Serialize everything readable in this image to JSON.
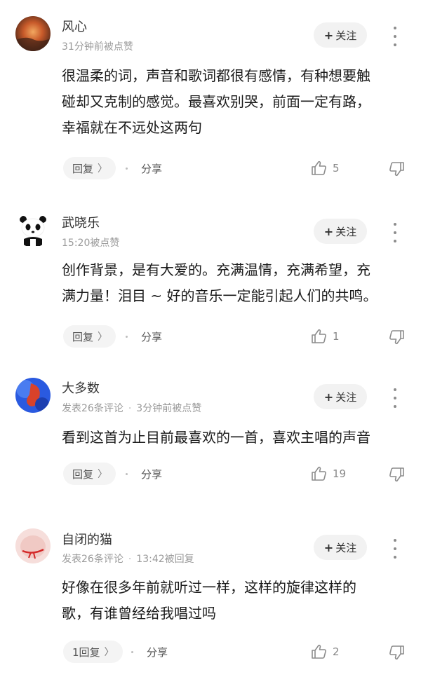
{
  "comments": [
    {
      "username": "风心",
      "meta": [
        "31分钟前被点赞"
      ],
      "follow_label": "关注",
      "content_lines": [
        "很温柔的词，声音和歌词都很有感情，有种想要触",
        "碰却又克制的感觉。最喜欢别哭，前面一定有路，",
        "幸福就在不远处这两句"
      ],
      "reply_label": "回复",
      "share_label": "分享",
      "likes": "5",
      "avatar_colors": [
        "#6a3a22",
        "#e08a3a"
      ]
    },
    {
      "username": "武晓乐",
      "meta": [
        "15:20被点赞"
      ],
      "follow_label": "关注",
      "content_lines": [
        "创作背景，是有大爱的。充满温情，充满希望，充",
        "满力量！泪目 ~ 好的音乐一定能引起人们的共鸣。"
      ],
      "reply_label": "回复",
      "share_label": "分享",
      "likes": "1",
      "avatar_colors": [
        "#ffffff",
        "#111111"
      ]
    },
    {
      "username": "大多数",
      "meta": [
        "发表26条评论",
        "3分钟前被点赞"
      ],
      "follow_label": "关注",
      "content_lines": [
        "看到这首为止目前最喜欢的一首，喜欢主唱的声音"
      ],
      "reply_label": "回复",
      "share_label": "分享",
      "likes": "19",
      "avatar_colors": [
        "#1f4fd6",
        "#d8422a"
      ]
    },
    {
      "username": "自闭的猫",
      "meta": [
        "发表26条评论",
        "13:42被回复"
      ],
      "follow_label": "关注",
      "content_lines": [
        "好像在很多年前就听过一样，这样的旋律这样的",
        "歌，有谁曾经给我唱过吗"
      ],
      "reply_label": "1回复",
      "share_label": "分享",
      "likes": "2",
      "avatar_colors": [
        "#f3d3d0",
        "#d42a2a"
      ]
    }
  ],
  "icons": {
    "avatar": "user-avatar",
    "follow": "plus-icon",
    "more": "more-vertical-icon",
    "reply": "chevron-right-icon",
    "like": "thumbs-up-icon",
    "dislike": "thumbs-down-icon"
  },
  "colors": {
    "text": "#1a1a1a",
    "meta": "#9a9a9a",
    "button_bg": "#f2f2f2"
  }
}
